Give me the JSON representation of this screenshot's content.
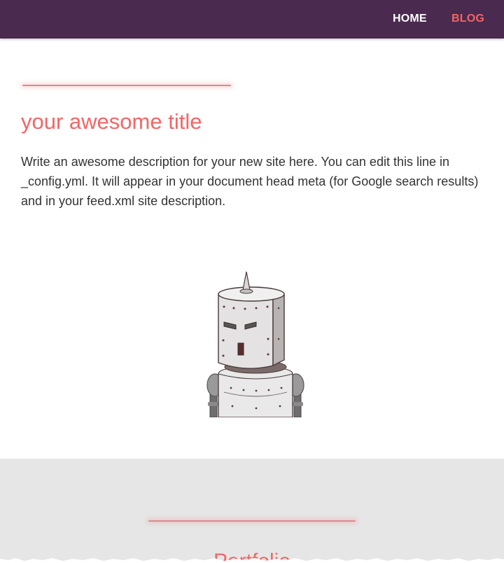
{
  "nav": {
    "home_label": "HOME",
    "blog_label": "BLOG"
  },
  "hero": {
    "title": "your awesome title",
    "description": "Write an awesome description for your new site here. You can edit this line in _config.yml. It will appear in your document head meta (for Google search results) and in your feed.xml site description.",
    "image_icon": "robot-illustration"
  },
  "portfolio": {
    "title": "Portfolio"
  },
  "colors": {
    "navbar_bg": "#4a2a4e",
    "accent": "#f26666",
    "section_gray": "#e6e6e6"
  }
}
